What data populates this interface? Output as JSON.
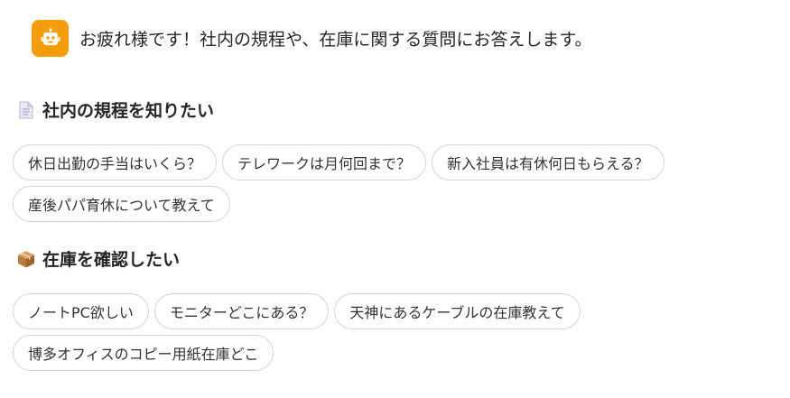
{
  "greeting": {
    "text": "お疲れ様です！社内の規程や、在庫に関する質問にお答えします。",
    "avatar_icon": "robot-icon",
    "avatar_color": "#f59e0b"
  },
  "sections": [
    {
      "title": "社内の規程を知りたい",
      "icon": "document-icon",
      "chips": [
        "休日出勤の手当はいくら？",
        "テレワークは月何回まで？",
        "新入社員は有休何日もらえる？",
        "産後パパ育休について教えて"
      ]
    },
    {
      "title": "在庫を確認したい",
      "icon": "package-icon",
      "chips": [
        "ノートPC欲しい",
        "モニターどこにある？",
        "天神にあるケーブルの在庫教えて",
        "博多オフィスのコピー用紙在庫どこ"
      ]
    }
  ]
}
